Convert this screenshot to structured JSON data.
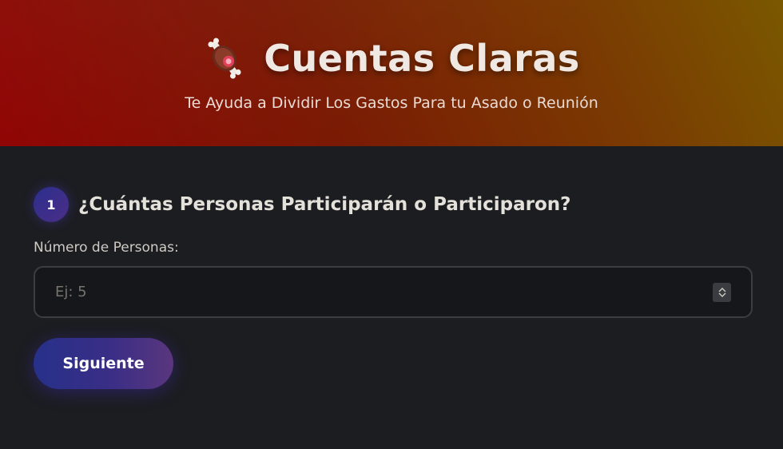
{
  "header": {
    "icon": "meat-on-bone-icon",
    "title": "Cuentas Claras",
    "subtitle": "Te Ayuda a Dividir Los Gastos Para tu Asado o Reunión"
  },
  "step": {
    "number": "1",
    "title": "¿Cuántas Personas Participarán o Participaron?"
  },
  "form": {
    "people_label": "Número de Personas:",
    "people_placeholder": "Ej: 5",
    "people_value": ""
  },
  "actions": {
    "next_label": "Siguiente"
  },
  "colors": {
    "header_start": "#8e0000",
    "header_end": "#7a5800",
    "background": "#1c1d21",
    "accent": "#3a2e86"
  }
}
